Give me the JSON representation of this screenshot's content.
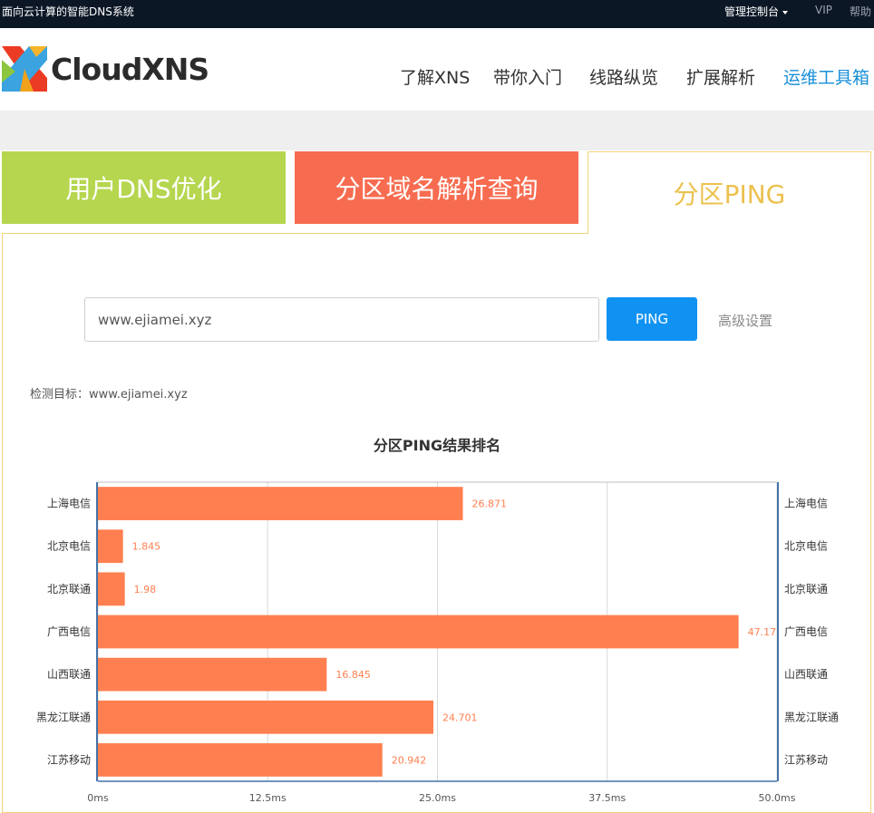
{
  "topbar": {
    "slogan": "面向云计算的智能DNS系统",
    "console": "管理控制台",
    "vip": "VIP",
    "help": "帮助"
  },
  "brand": {
    "name": "CloudXNS"
  },
  "nav": [
    {
      "label": "了解XNS"
    },
    {
      "label": "带你入门"
    },
    {
      "label": "线路纵览"
    },
    {
      "label": "扩展解析"
    },
    {
      "label": "运维工具箱"
    }
  ],
  "tabs": {
    "dns_opt": "用户DNS优化",
    "zone_query": "分区域名解析查询",
    "zone_ping": "分区PING"
  },
  "search": {
    "value": "www.ejiamei.xyz",
    "button": "PING",
    "advanced": "高级设置"
  },
  "target": {
    "text": "检测目标：www.ejiamei.xyz"
  },
  "chart": {
    "title": "分区PING结果排名"
  },
  "colors": {
    "bar": "#ff7f50",
    "axis": "#4572a7",
    "brand_blue": "#1a8fd8"
  },
  "chart_data": {
    "type": "bar",
    "orientation": "horizontal",
    "title": "分区PING结果排名",
    "categories": [
      "上海电信",
      "北京电信",
      "北京联通",
      "广西电信",
      "山西联通",
      "黑龙江联通",
      "江苏移动"
    ],
    "values": [
      26.871,
      1.845,
      1.98,
      47.17,
      16.845,
      24.701,
      20.942
    ],
    "value_labels": [
      "26.871",
      "1.845",
      "1.98",
      "47.17",
      "16.845",
      "24.701",
      "20.942"
    ],
    "xlim": [
      0,
      50
    ],
    "xticks": [
      "0ms",
      "12.5ms",
      "25.0ms",
      "37.5ms",
      "50.0ms"
    ],
    "grid": true,
    "legend": "none"
  }
}
